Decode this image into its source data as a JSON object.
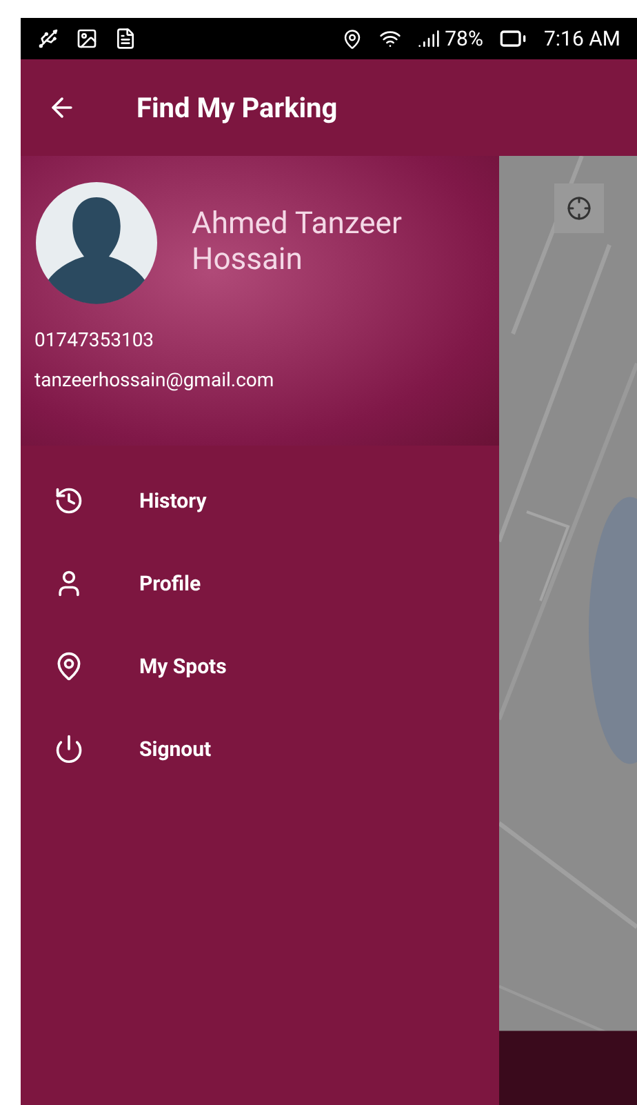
{
  "status_bar": {
    "battery": "78%",
    "time": "7:16 AM"
  },
  "app_bar": {
    "title": "Find My Parking"
  },
  "drawer": {
    "name": "Ahmed Tanzeer Hossain",
    "phone": "01747353103",
    "email": "tanzeerhossain@gmail.com",
    "items": [
      {
        "kind": "history",
        "label": "History"
      },
      {
        "kind": "profile",
        "label": "Profile"
      },
      {
        "kind": "spots",
        "label": "My Spots"
      },
      {
        "kind": "signout",
        "label": "Signout"
      }
    ]
  }
}
